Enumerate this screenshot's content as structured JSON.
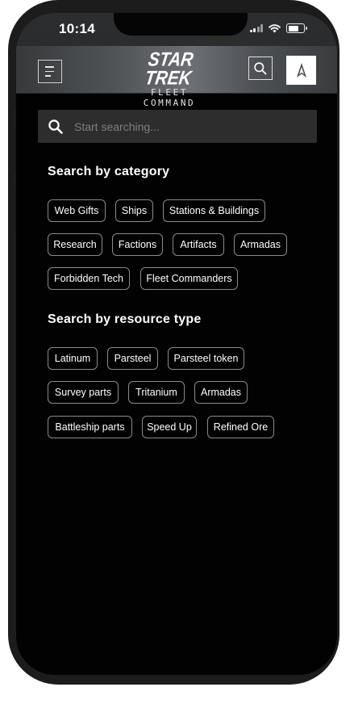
{
  "status_bar": {
    "time": "10:14"
  },
  "header": {
    "logo_main": "STAR TREK",
    "logo_sub": "FLEET COMMAND"
  },
  "search": {
    "placeholder": "Start searching..."
  },
  "categories": {
    "title": "Search by category",
    "chips": [
      "Web Gifts",
      "Ships",
      "Stations & Buildings",
      "Research",
      "Factions",
      "Artifacts",
      "Armadas",
      "Forbidden Tech",
      "Fleet Commanders"
    ]
  },
  "resources": {
    "title": "Search by resource type",
    "chips": [
      "Latinum",
      "Parsteel",
      "Parsteel token",
      "Survey parts",
      "Tritanium",
      "Armadas",
      "Battleship parts",
      "Speed Up",
      "Refined Ore"
    ]
  },
  "icons": {
    "menu": "hamburger-menu-icon",
    "search": "search-icon",
    "avatar": "delta-insignia-icon",
    "signal": "cellular-signal-icon",
    "wifi": "wifi-icon",
    "battery": "battery-icon"
  },
  "colors": {
    "background": "#020202",
    "header": "#4d5054",
    "search_box": "#2d2d2d",
    "chip_border": "#8a8a8a",
    "text": "#ffffff"
  }
}
